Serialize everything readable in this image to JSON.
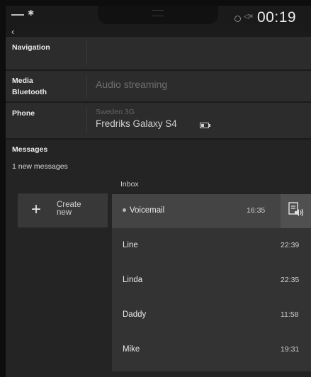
{
  "status_bar": {
    "time": "00:19",
    "bluetooth_glyph": "✱",
    "back_glyph": "‹",
    "volume_glyph": "◁×",
    "page_dots": 3,
    "active_page": 2
  },
  "rows": {
    "navigation": {
      "label": "Navigation"
    },
    "media": {
      "label_line1": "Media",
      "label_line2": "Bluetooth",
      "value": "Audio streaming"
    },
    "phone": {
      "label": "Phone",
      "network": "Sweden 3G",
      "device": "Fredriks Galaxy S4",
      "battery_level": 0.4
    }
  },
  "messages": {
    "title": "Messages",
    "count_text": "1 new messages",
    "inbox_label": "Inbox",
    "create_plus": "+",
    "create_label_line1": "Create",
    "create_label_line2": "new",
    "items": [
      {
        "name": "Voicemail",
        "time": "16:35",
        "unread": true
      },
      {
        "name": "Line",
        "time": "22:39",
        "unread": false
      },
      {
        "name": "Linda",
        "time": "22:35",
        "unread": false
      },
      {
        "name": "Daddy",
        "time": "11:58",
        "unread": false
      },
      {
        "name": "Mike",
        "time": "19:31",
        "unread": false
      }
    ]
  },
  "colors": {
    "background": "#1b1b1b",
    "row": "#2c2c2c",
    "list": "#333333",
    "active_item": "#444444",
    "text": "#e8e8e8",
    "muted": "#6e6e6e"
  },
  "icons": {
    "status": [
      "signal-icon",
      "bluetooth-icon",
      "recording-icon",
      "volume-muted-icon"
    ],
    "phone": "battery-icon",
    "create": "plus-icon",
    "voicemail_action": "read-aloud-icon"
  }
}
